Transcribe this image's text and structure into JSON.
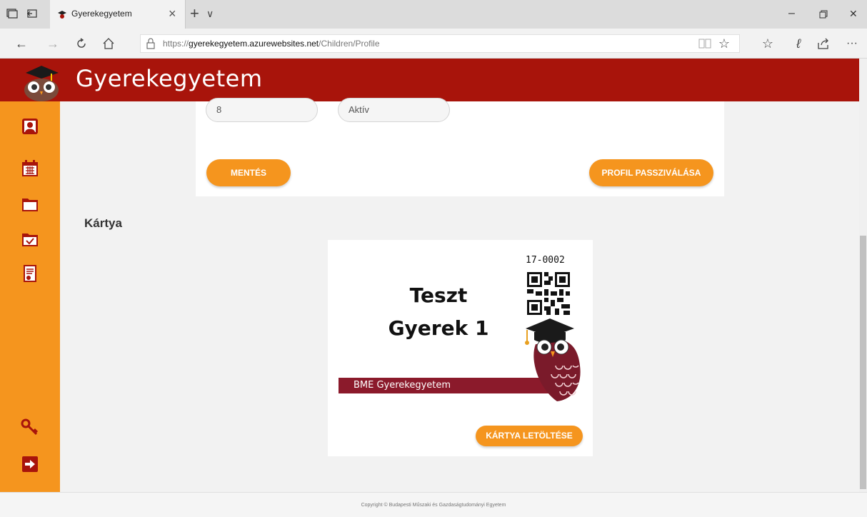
{
  "browser": {
    "tab_title": "Gyerekegyetem",
    "tab_close": "×",
    "new_tab": "+",
    "tab_menu": "∨",
    "url_prefix": "https://",
    "url_host": "gyerekegyetem.azurewebsites.net",
    "url_path": "/Children/Profile",
    "win_min": "–",
    "win_close": "✕",
    "more": "···"
  },
  "app": {
    "brand": "Gyerekegyetem"
  },
  "form": {
    "field_number": "8",
    "field_status": "Aktív",
    "save_label": "MENTÉS",
    "deactivate_label": "PROFIL PASSZIVÁLÁSA"
  },
  "card_section": {
    "heading": "Kártya",
    "card_id": "17-0002",
    "name_line1": "Teszt",
    "name_line2": "Gyerek 1",
    "banner": "BME Gyerekegyetem",
    "download_label": "KÁRTYA LETÖLTÉSE"
  },
  "footer": {
    "copyright": "Copyright © Budapesti Műszaki és Gazdaságtudományi Egyetem"
  },
  "colors": {
    "header": "#a8140b",
    "accent": "#f5951e",
    "banner": "#8b1a2b"
  }
}
